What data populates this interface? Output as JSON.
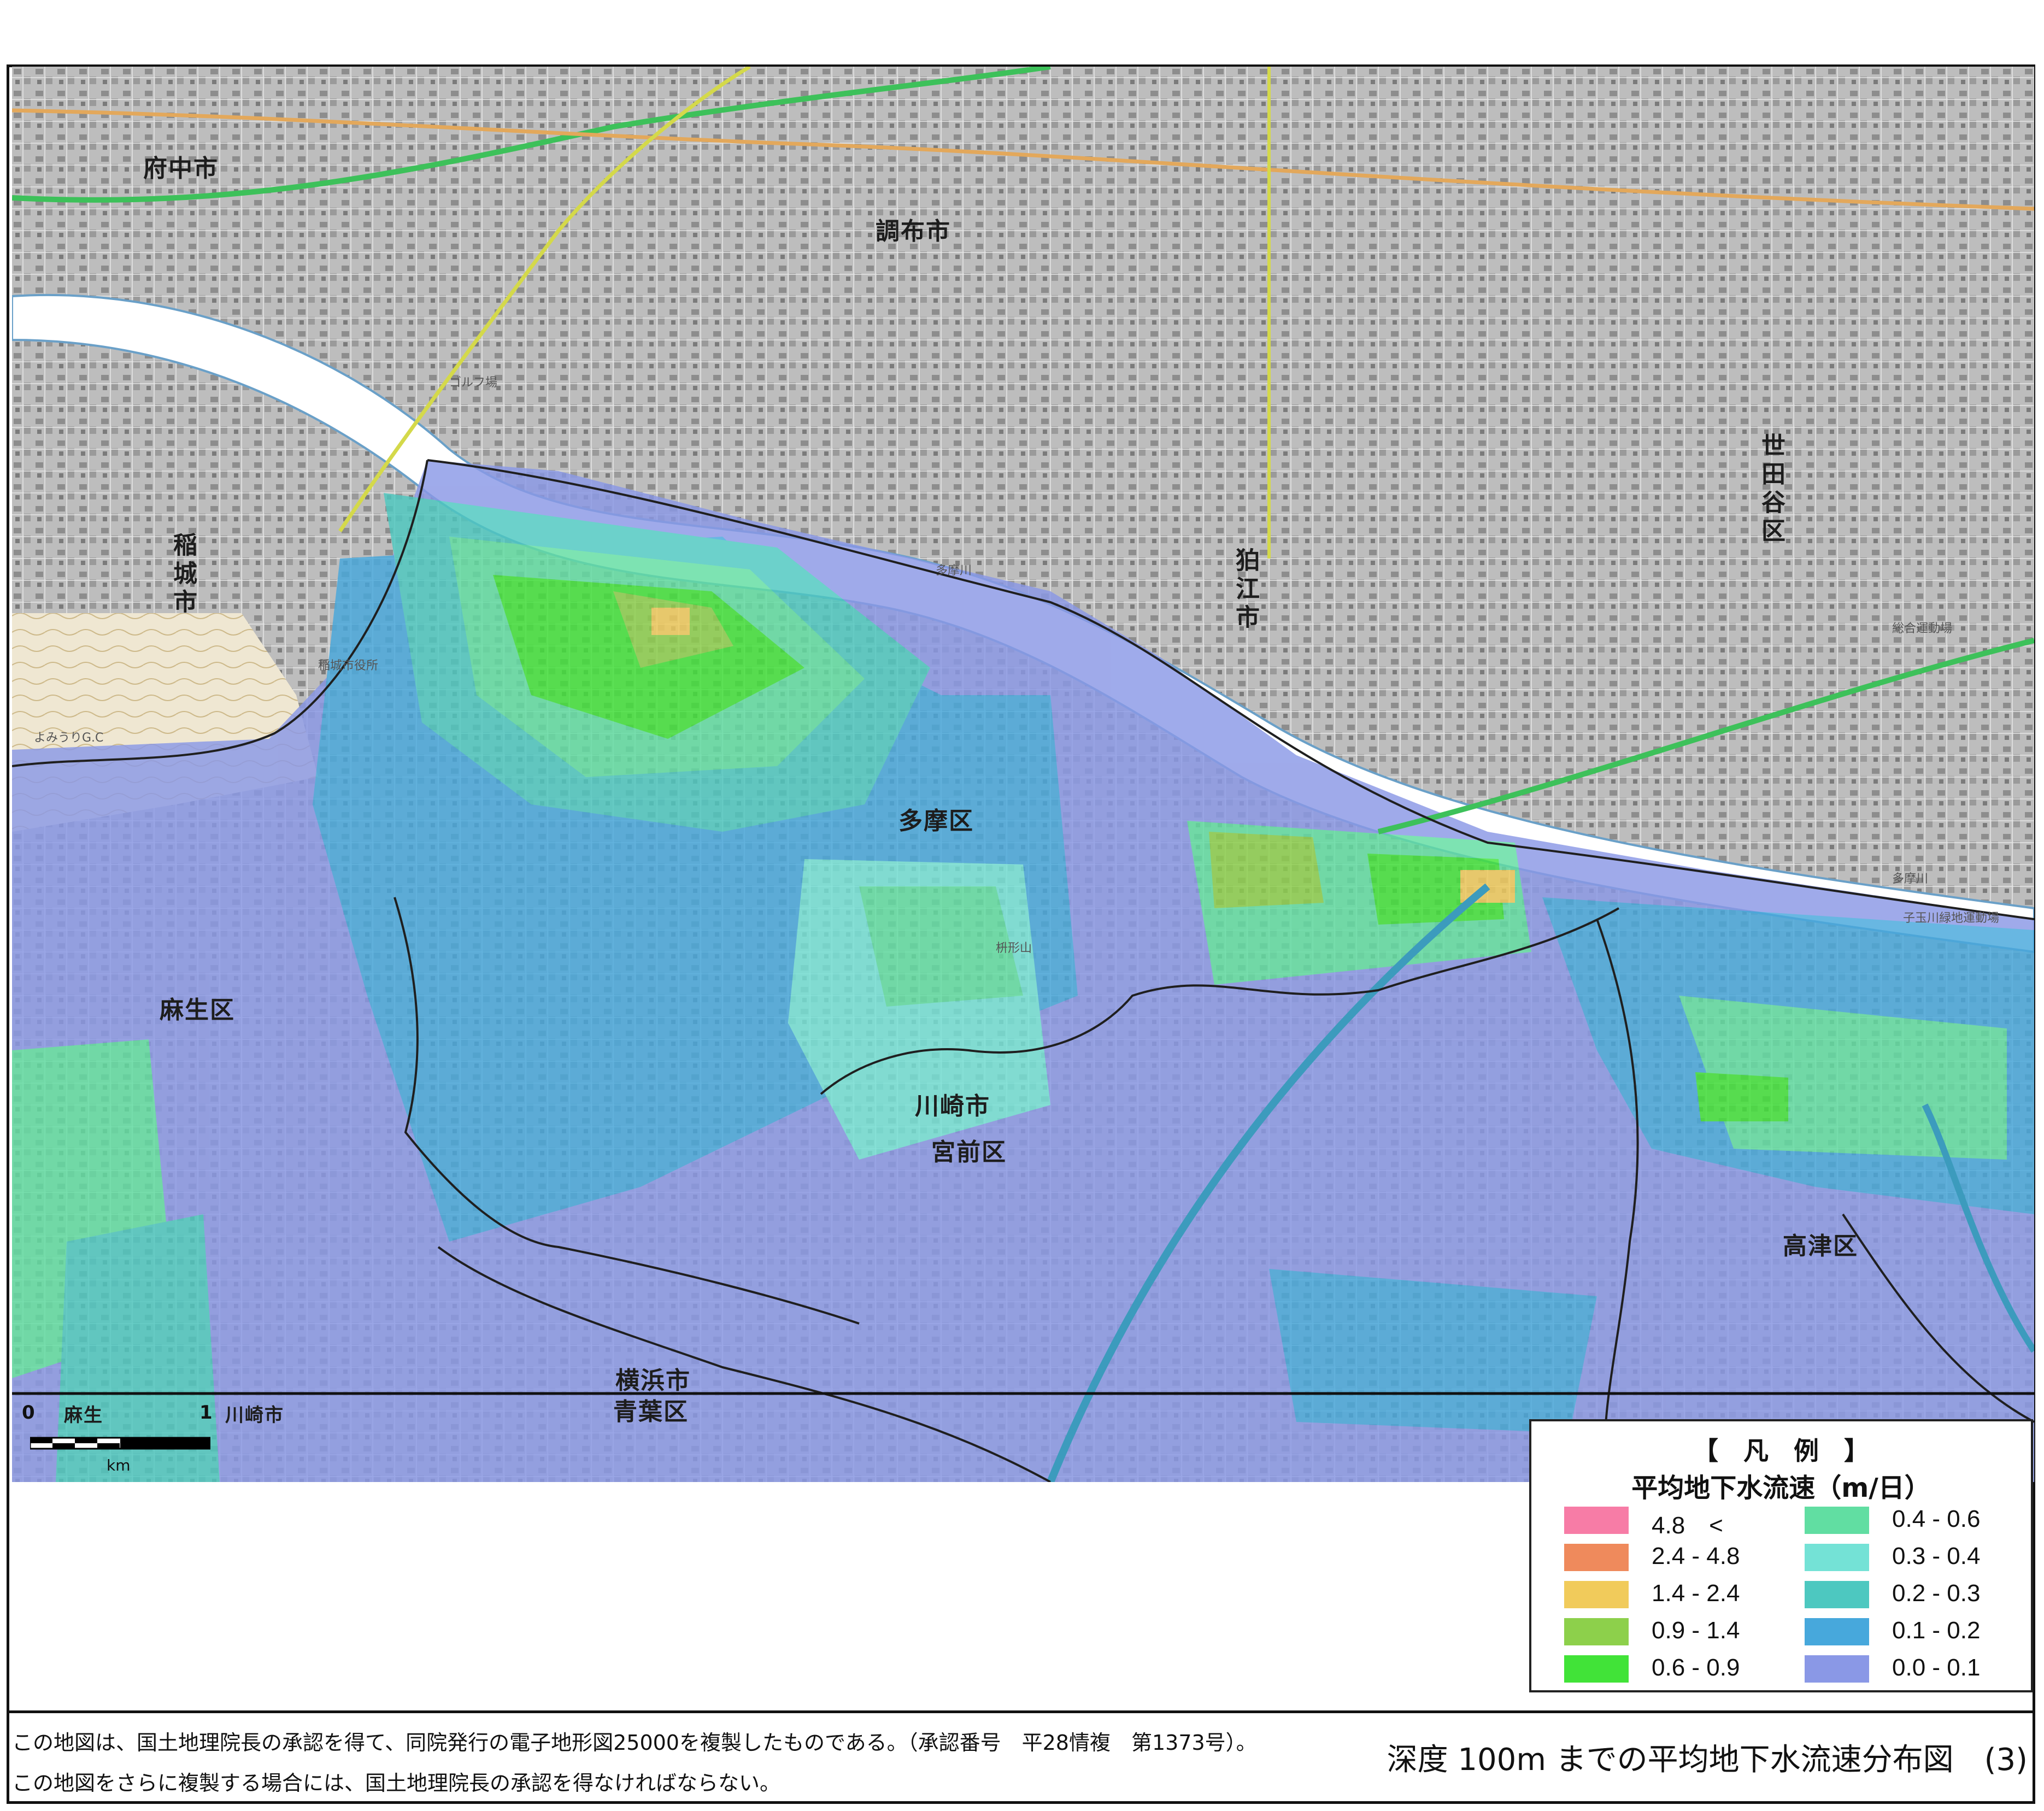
{
  "map": {
    "places": [
      {
        "name": "府中市",
        "vertical": false
      },
      {
        "name": "調布市",
        "vertical": false
      },
      {
        "name": "世田谷区",
        "vertical": true
      },
      {
        "name": "狛江市",
        "vertical": true
      },
      {
        "name": "稲城市",
        "vertical": true
      },
      {
        "name": "多摩区",
        "vertical": false
      },
      {
        "name": "麻生区",
        "vertical": false
      },
      {
        "name": "川崎市",
        "vertical": false
      },
      {
        "name": "宮前区",
        "vertical": false
      },
      {
        "name": "高津区",
        "vertical": false
      },
      {
        "name": "横浜市",
        "vertical": false
      },
      {
        "name": "青葉区",
        "vertical": false
      },
      {
        "name": "川崎市",
        "vertical": false
      },
      {
        "name": "麻生",
        "vertical": false
      }
    ],
    "small_labels": [
      "多摩川",
      "稲城市役所",
      "よみうりG.C",
      "ゴルフ場",
      "枡形山",
      "総合運動場",
      "多摩川",
      "子玉川緑地運動場"
    ],
    "scale": {
      "zero": "0",
      "one": "1",
      "unit": "km"
    }
  },
  "legend": {
    "title": "【　凡　例　】",
    "subtitle": "平均地下水流速（m/日）",
    "items": [
      {
        "label": "4.8　<",
        "color": "#f77ca6"
      },
      {
        "label": "2.4 - 4.8",
        "color": "#ef8a5c"
      },
      {
        "label": "1.4 - 2.4",
        "color": "#f1cb5b"
      },
      {
        "label": "0.9 - 1.4",
        "color": "#8dd04b"
      },
      {
        "label": "0.6 - 0.9",
        "color": "#41e338"
      },
      {
        "label": "0.4 - 0.6",
        "color": "#61dea2"
      },
      {
        "label": "0.3 - 0.4",
        "color": "#74e2d6"
      },
      {
        "label": "0.2 - 0.3",
        "color": "#4dc8c0"
      },
      {
        "label": "0.1 - 0.2",
        "color": "#47a8dc"
      },
      {
        "label": "0.0 - 0.1",
        "color": "#8a98e6"
      }
    ]
  },
  "footer": {
    "note1": "この地図は、国土地理院長の承認を得て、同院発行の電子地形図25000を複製したものである。（承認番号　平28情複　第1373号）。",
    "note2": "この地図をさらに複製する場合には、国土地理院長の承認を得なければならない。",
    "title": "深度 100m までの平均地下水流速分布図　(3)"
  }
}
